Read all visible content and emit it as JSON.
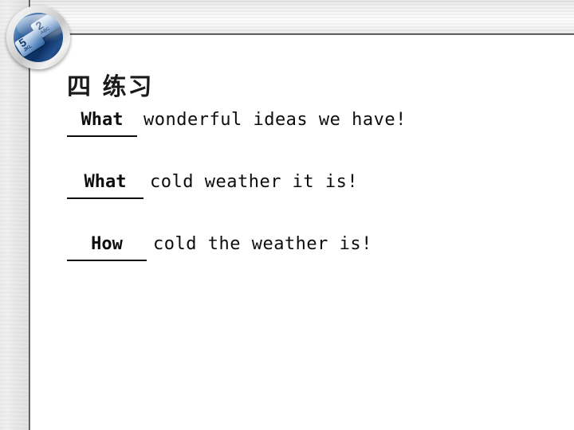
{
  "slide": {
    "title": "四 练习",
    "logo": {
      "name": "phone-keypad-badge",
      "key_top_number": "2",
      "key_top_letters": "ABC",
      "key_bottom_number": "5",
      "key_bottom_letters": "JKL"
    },
    "exercises": [
      {
        "blank_answer": "What",
        "sentence": "wonderful ideas we have!"
      },
      {
        "blank_answer": "What",
        "sentence": "cold weather it is!"
      },
      {
        "blank_answer": "How",
        "sentence": "cold the weather is!"
      }
    ]
  },
  "colors": {
    "text": "#0d0d0d",
    "rule": "#4a4a4a",
    "metal_light": "#f6f6f6",
    "metal_dark": "#cfcfcf",
    "badge_blue": "#123a74"
  }
}
